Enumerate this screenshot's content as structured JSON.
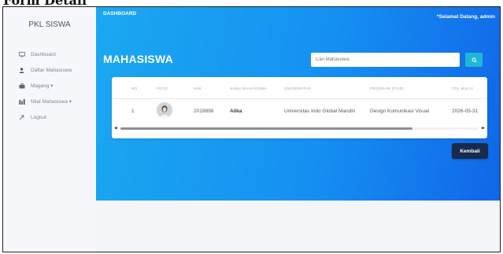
{
  "top_cropped_title": "Form Detail",
  "sidebar": {
    "brand": "PKL SISWA",
    "items": [
      {
        "icon": "monitor-icon",
        "label": "Dashboard"
      },
      {
        "icon": "user-icon",
        "label": "Daftar Mahasiswa"
      },
      {
        "icon": "briefcase-icon",
        "label": "Magang ▾"
      },
      {
        "icon": "bar-chart-icon",
        "label": "Nilai Mahasiswa ▾"
      },
      {
        "icon": "logout-icon",
        "label": "Logout"
      }
    ]
  },
  "header": {
    "left": "DASHBOARD",
    "greeting": "*Selamat Datang, ",
    "user": "admin"
  },
  "page": {
    "title": "MAHASISWA",
    "search_placeholder": "Cari Mahasiswa",
    "back_button": "Kembali"
  },
  "table": {
    "columns": [
      "NO",
      "FOTO",
      "NIM",
      "NAMA MAHASISWA",
      "UNIVERSITAS",
      "PROGRAM STUDI",
      "TGL MULAI"
    ],
    "rows": [
      {
        "no": "1",
        "nim": "2019898",
        "nama": "Alika",
        "universitas": "Universitas Indo Global Mandiri",
        "prodi": "Design Komunikasi Visual",
        "tgl_mulai": "2026-05-31"
      }
    ]
  },
  "colors": {
    "hero_start": "#1ba8f0",
    "hero_end": "#1166e8",
    "search_button": "#1fb7d6",
    "back_button": "#172b4d"
  }
}
